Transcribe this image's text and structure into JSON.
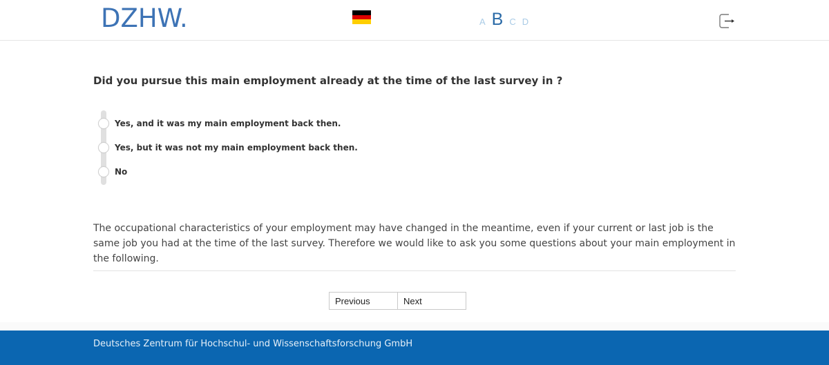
{
  "header": {
    "logo_text": "DZHW.",
    "language_flag": "german-flag",
    "flag_colors": [
      "#000000",
      "#dd0000",
      "#ffce00"
    ],
    "font_sizes": [
      "A",
      "B",
      "C",
      "D"
    ],
    "active_font_size": "B",
    "logout_icon": "logout-icon"
  },
  "main": {
    "question": "Did you pursue this main employment already at the time of the last survey in ?",
    "options": [
      {
        "label": "Yes, and it was my main employment back then."
      },
      {
        "label": "Yes, but it was not my main employment back then."
      },
      {
        "label": "No"
      }
    ],
    "info_text": "The occupational characteristics of your employment may have changed in the meantime, even if your current or last job is the same job you had at the time of the last survey. Therefore we would like to ask you some questions about your main employment in the following."
  },
  "nav": {
    "previous_label": "Previous",
    "next_label": "Next"
  },
  "footer": {
    "text": "Deutsches Zentrum für Hochschul- und Wissenschaftsforschung GmbH",
    "color": "#0b66b1"
  }
}
